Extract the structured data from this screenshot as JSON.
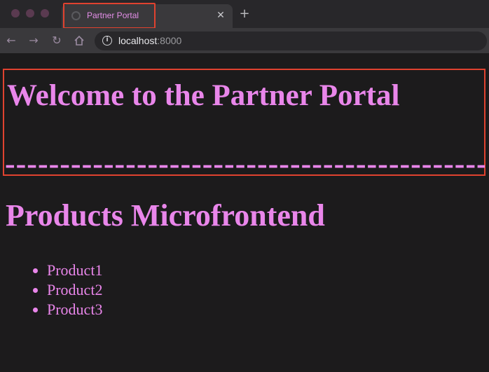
{
  "browser": {
    "tab_title": "Partner Portal",
    "close_symbol": "✕",
    "new_tab_symbol": "+",
    "url_host": "localhost",
    "url_port": ":8000",
    "icons": [
      "back-arrow-icon",
      "forward-arrow-icon",
      "reload-icon",
      "home-icon",
      "info-icon"
    ]
  },
  "page": {
    "header_title": "Welcome to the Partner Portal",
    "header_rule": "-------------------------------------------------------",
    "microfrontend_title": "Products Microfrontend",
    "products": [
      "Product1",
      "Product2",
      "Product3"
    ]
  },
  "colors": {
    "text_accent": "#e986ea",
    "highlight_box": "#e0422f",
    "page_background": "#1c1b1c"
  }
}
